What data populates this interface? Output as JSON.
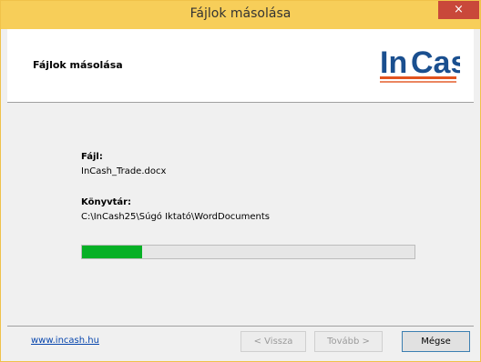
{
  "window": {
    "title": "Fájlok másolása",
    "close_glyph": "×"
  },
  "header": {
    "title": "Fájlok másolása",
    "logo_text_in": "In",
    "logo_text_cash": "Cash",
    "logo_colors": {
      "blue": "#1a4f8f",
      "orange": "#e2531e"
    }
  },
  "content": {
    "file_label": "Fájl:",
    "file_value": "InCash_Trade.docx",
    "dir_label": "Könyvtár:",
    "dir_value": "C:\\InCash25\\Súgó Iktató\\WordDocuments",
    "progress_fraction": 0.18,
    "progress_color": "#06b025"
  },
  "footer": {
    "link": "www.incash.hu",
    "back_label": "< Vissza",
    "next_label": "Tovább >",
    "cancel_label": "Mégse"
  }
}
